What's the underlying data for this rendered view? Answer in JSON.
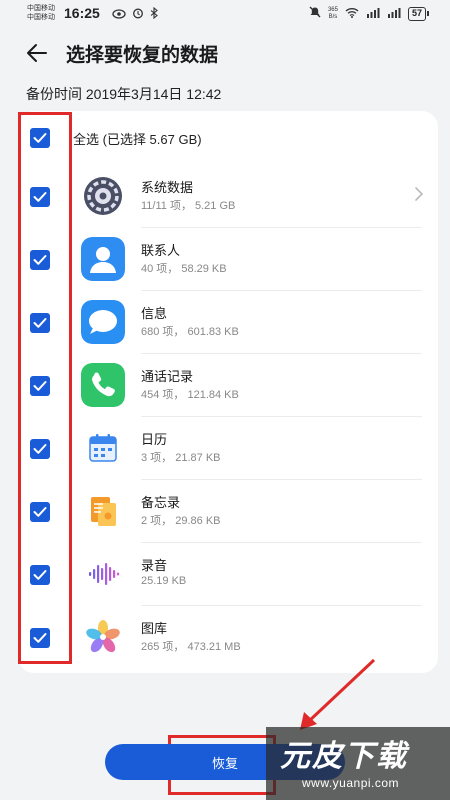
{
  "status_bar": {
    "carrier_1": "中国移动",
    "carrier_2": "中国移动",
    "time": "16:25",
    "net_speed_value": "365",
    "net_speed_unit": "B/s",
    "battery": "57"
  },
  "header": {
    "title": "选择要恢复的数据",
    "backup_time": "备份时间 2019年3月14日 12:42"
  },
  "select_all": {
    "label": "全选 (已选择 5.67 GB)",
    "checked": true
  },
  "items": [
    {
      "name": "系统数据",
      "meta": "11/11 项，  5.21 GB",
      "icon": "system-data-icon",
      "checked": true,
      "has_chevron": true
    },
    {
      "name": "联系人",
      "meta": "40 项，  58.29 KB",
      "icon": "contacts-icon",
      "checked": true
    },
    {
      "name": "信息",
      "meta": "680 项，  601.83 KB",
      "icon": "messages-icon",
      "checked": true
    },
    {
      "name": "通话记录",
      "meta": "454 项，  121.84 KB",
      "icon": "call-log-icon",
      "checked": true
    },
    {
      "name": "日历",
      "meta": "3 项，  21.87 KB",
      "icon": "calendar-icon",
      "checked": true
    },
    {
      "name": "备忘录",
      "meta": "2 项，  29.86 KB",
      "icon": "notes-icon",
      "checked": true
    },
    {
      "name": "录音",
      "meta": "25.19 KB",
      "icon": "recorder-icon",
      "checked": true
    },
    {
      "name": "图库",
      "meta": "265 项，  473.21 MB",
      "icon": "gallery-icon",
      "checked": true
    }
  ],
  "restore_button": {
    "label": "恢复"
  },
  "watermark": {
    "logo": "元皮下载",
    "url": "www.yuanpi.com"
  },
  "colors": {
    "accent": "#1a5cd8",
    "annotation": "#e02a2a",
    "card": "#ffffff",
    "background": "#f1f3f5"
  }
}
